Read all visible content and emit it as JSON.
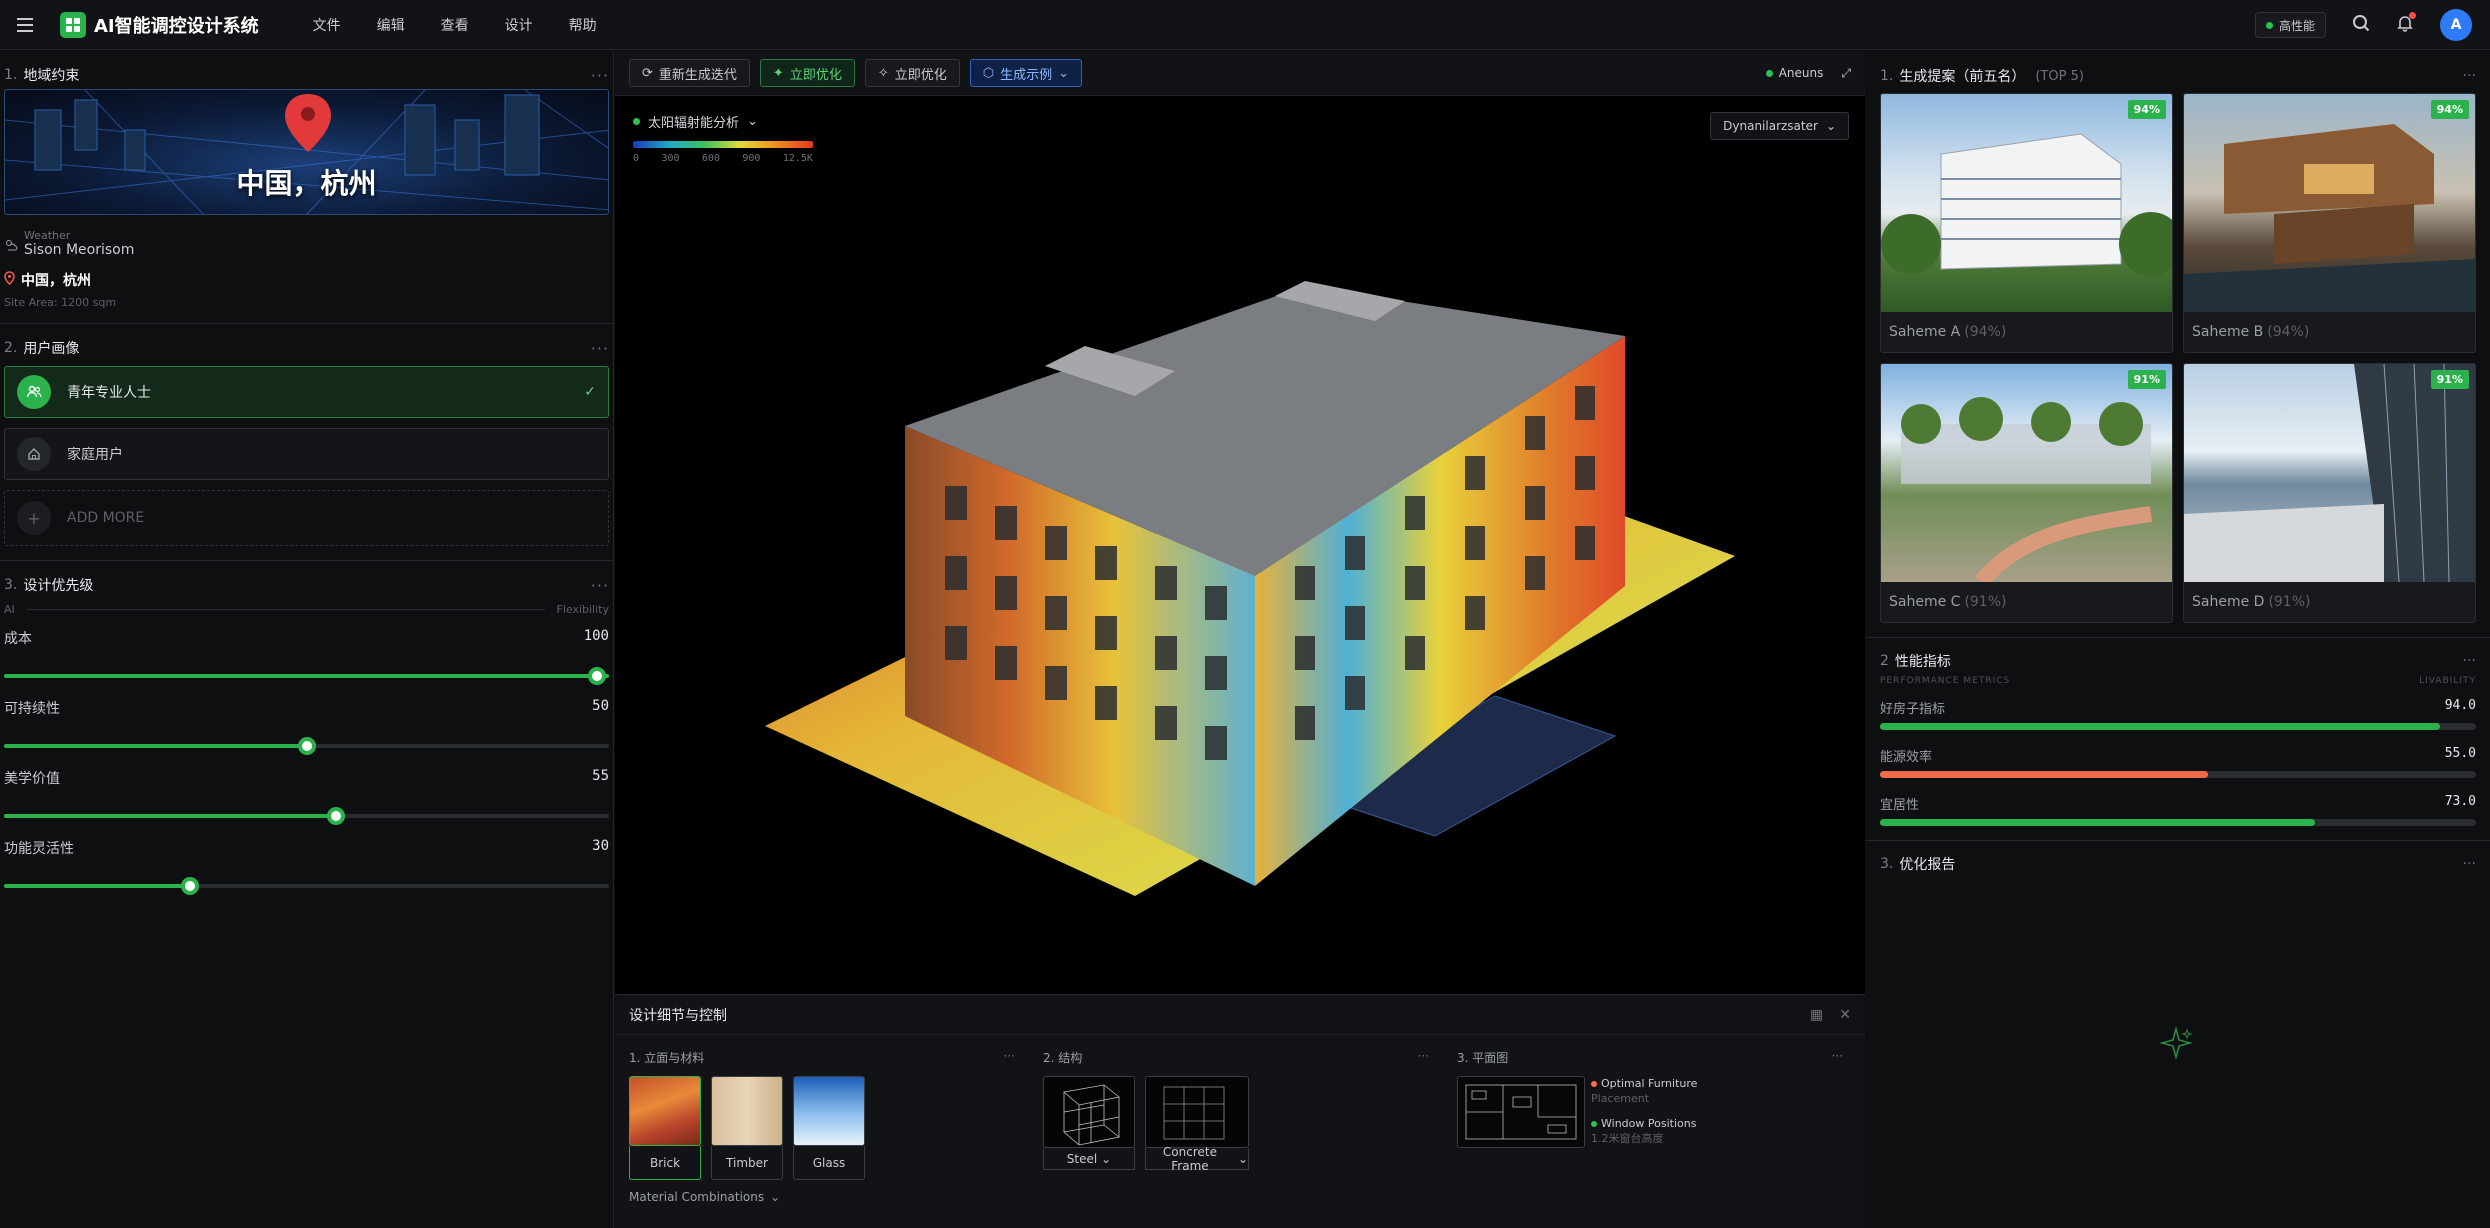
{
  "app": {
    "title": "AI智能调控设计系统"
  },
  "menu": [
    "文件",
    "编辑",
    "查看",
    "设计",
    "帮助"
  ],
  "topbar": {
    "perf_badge": "高性能",
    "avatar_initial": "A"
  },
  "left": {
    "site": {
      "num": "1.",
      "title": "地域约束",
      "map_label": "中国，杭州",
      "weather_label": "Weather",
      "weather_value": "Sison Meorisom",
      "location": "中国，杭州",
      "site_area": "Site Area: 1200 sqm"
    },
    "persona": {
      "num": "2.",
      "title": "用户画像",
      "items": [
        "青年专业人士",
        "家庭用户"
      ],
      "add_more": "ADD MORE"
    },
    "priority": {
      "num": "3.",
      "title": "设计优先级",
      "scale_left": "AI",
      "scale_right": "Flexibility",
      "sliders": [
        {
          "label": "成本",
          "value": 100
        },
        {
          "label": "可持续性",
          "value": 50
        },
        {
          "label": "美学价值",
          "value": 55
        },
        {
          "label": "功能灵活性",
          "value": 30
        }
      ]
    }
  },
  "toolbar": {
    "regen": "重新生成迭代",
    "optimize_green": "立即优化",
    "optimize": "立即优化",
    "generate_sample": "生成示例",
    "status": "Aneuns"
  },
  "viewport": {
    "analysis_title": "太阳辐射能分析",
    "scale_labels": [
      "0",
      "300",
      "600",
      "900",
      "12.5K"
    ],
    "dropdown": "Dynanilarzsater"
  },
  "details": {
    "title": "设计细节与控制",
    "facade": {
      "title": "1. 立面与材料",
      "materials": [
        "Brick",
        "Timber",
        "Glass"
      ],
      "combinations": "Material Combinations"
    },
    "structure": {
      "title": "2. 结构",
      "items": [
        "Steel",
        "Concrete Frame"
      ]
    },
    "plan": {
      "title": "3. 平面图",
      "note1": "Optimal Furniture",
      "note1_sub": "Placement",
      "note2": "Window Positions",
      "note2_sub": "1.2米窗台高度"
    }
  },
  "right": {
    "schemes": {
      "num": "1.",
      "title": "生成提案（前五名）",
      "sub": "(TOP 5)",
      "cards": [
        {
          "name": "Saheme A",
          "pct": "(94%)",
          "badge": "94%"
        },
        {
          "name": "Saheme B",
          "pct": "(94%)",
          "badge": "94%"
        },
        {
          "name": "Saheme C",
          "pct": "(91%)",
          "badge": "91%"
        },
        {
          "name": "Saheme D",
          "pct": "(91%)",
          "badge": "91%"
        }
      ]
    },
    "metrics": {
      "num": "2",
      "title": "性能指标",
      "sub_left": "PERFORMANCE METRICS",
      "sub_right": "LIVABILITY",
      "items": [
        {
          "label": "好房子指标",
          "value": "94.0",
          "fraction": 0.94,
          "color": "#2bb24c"
        },
        {
          "label": "能源效率",
          "value": "55.0",
          "fraction": 0.55,
          "color": "#f06a4a"
        },
        {
          "label": "宜居性",
          "value": "73.0",
          "fraction": 0.73,
          "color": "#2bb24c"
        }
      ]
    },
    "report": {
      "num": "3.",
      "title": "优化报告"
    }
  }
}
